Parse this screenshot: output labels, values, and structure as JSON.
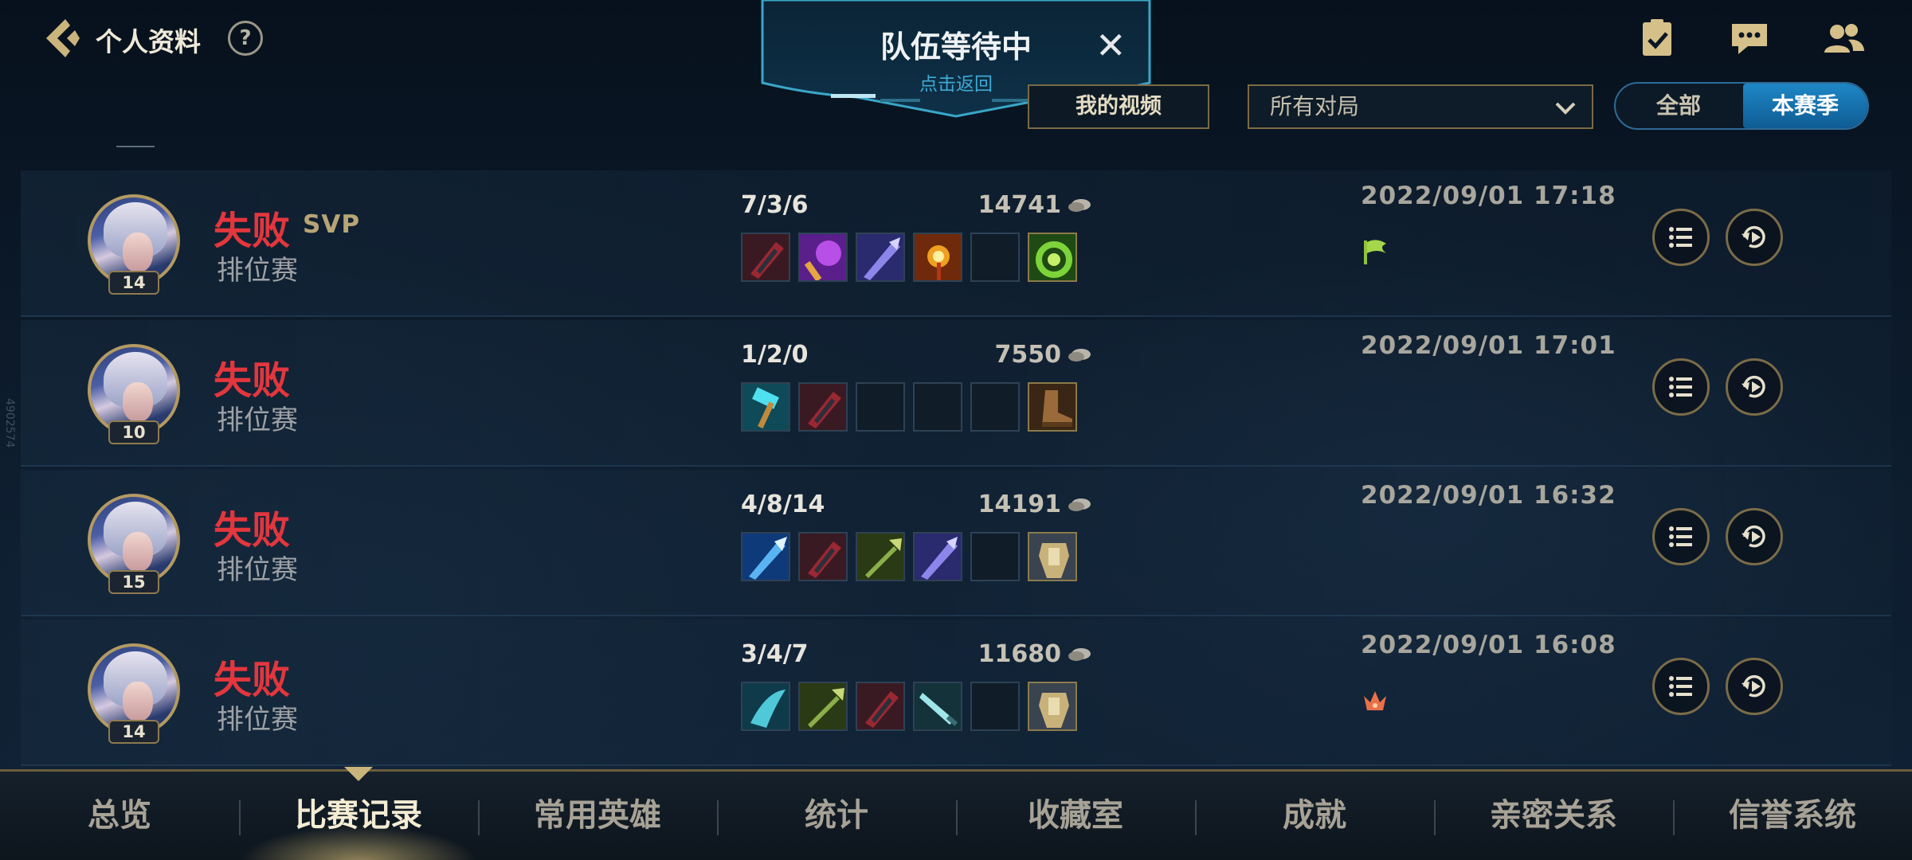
{
  "header": {
    "title": "个人资料",
    "help_label": "?"
  },
  "top_icons": [
    "clipboard-check-icon",
    "chat-icon",
    "friends-icon"
  ],
  "queue_banner": {
    "title": "队伍等待中",
    "subtitle": "点击返回",
    "close_label": "✕"
  },
  "filters": {
    "my_videos_label": "我的视频",
    "match_type_value": "所有对局",
    "segment": {
      "all_label": "全部",
      "season_label": "本赛季",
      "selected": "本赛季"
    }
  },
  "side_mark": "4902574",
  "matches": [
    {
      "level": "14",
      "result": "失败",
      "badge": "SVP",
      "mode": "排位赛",
      "kda": "7/3/6",
      "gold": "14741",
      "date": "2022/09/01 17:18",
      "status_icon": "flag-icon",
      "items": [
        "dark-blade",
        "purple-wand",
        "violet-spear",
        "flame-staff",
        "empty",
        "green-ring"
      ]
    },
    {
      "level": "10",
      "result": "失败",
      "badge": "",
      "mode": "排位赛",
      "kda": "1/2/0",
      "gold": "7550",
      "date": "2022/09/01 17:01",
      "status_icon": "",
      "items": [
        "cyan-hammer",
        "dark-blade",
        "empty",
        "empty",
        "empty",
        "boots"
      ]
    },
    {
      "level": "15",
      "result": "失败",
      "badge": "",
      "mode": "排位赛",
      "kda": "4/8/14",
      "gold": "14191",
      "date": "2022/09/01 16:32",
      "status_icon": "",
      "items": [
        "blue-spear",
        "dark-blade",
        "green-trident",
        "violet-spear",
        "empty",
        "gold-armor"
      ]
    },
    {
      "level": "14",
      "result": "失败",
      "badge": "",
      "mode": "排位赛",
      "kda": "3/4/7",
      "gold": "11680",
      "date": "2022/09/01 16:08",
      "status_icon": "crown-icon",
      "items": [
        "teal-claw",
        "green-trident",
        "dark-blade",
        "cyan-dagger",
        "empty",
        "gold-armor"
      ]
    }
  ],
  "nav": {
    "tabs": [
      "总览",
      "比赛记录",
      "常用英雄",
      "统计",
      "收藏室",
      "成就",
      "亲密关系",
      "信誉系统"
    ],
    "active_index": 1
  },
  "colors": {
    "defeat": "#e3363d",
    "accent_blue": "#1e87c6",
    "gold_border": "#7a6a43"
  }
}
